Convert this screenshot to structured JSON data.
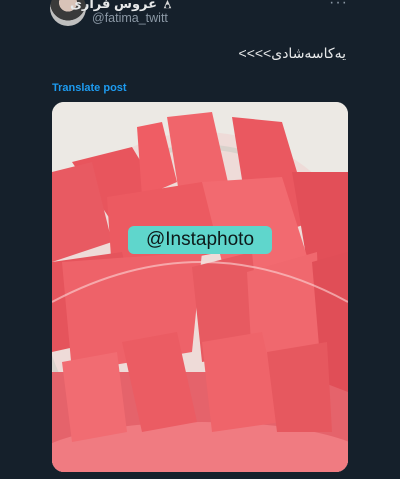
{
  "post": {
    "author_name": "عروس فراری",
    "author_handle": "@fatima_twitt",
    "text": "یەکاسەشادی>>>>",
    "translate_label": "Translate post",
    "more_icon": "more-dots-icon",
    "badge_icon": "emoji-badge-icon"
  },
  "media": {
    "description_icon": "watermelon-photo",
    "watermark": "@Instaphoto"
  },
  "colors": {
    "background": "#15202b",
    "link": "#1d9bf0",
    "muted": "#8b98a5",
    "watermark_bg": "#5fd6cc"
  }
}
